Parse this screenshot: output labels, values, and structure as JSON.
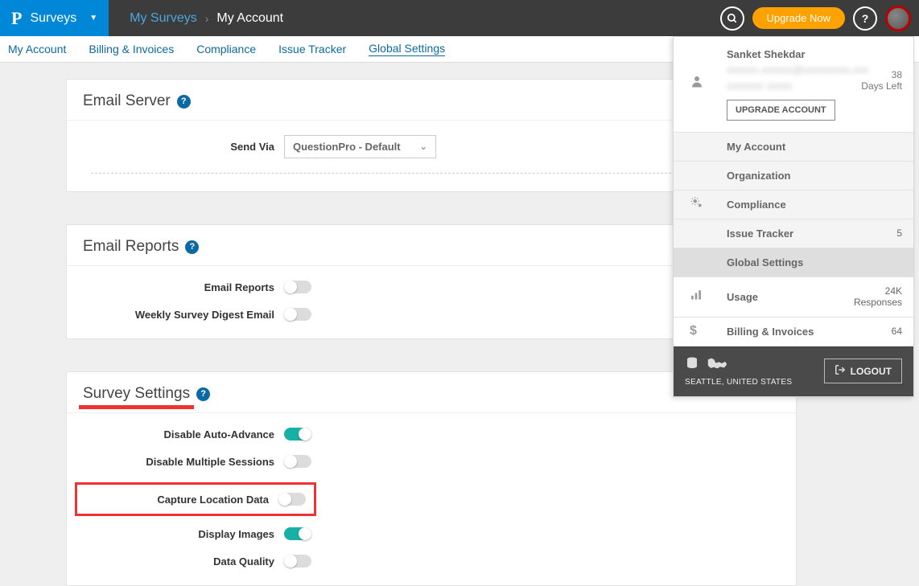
{
  "header": {
    "brand_label": "Surveys",
    "breadcrumb_parent": "My Surveys",
    "breadcrumb_current": "My Account",
    "upgrade_label": "Upgrade Now"
  },
  "subtabs": {
    "items": [
      "My Account",
      "Billing & Invoices",
      "Compliance",
      "Issue Tracker",
      "Global Settings"
    ],
    "active_index": 4
  },
  "panels": {
    "email_server": {
      "title": "Email Server",
      "send_via_label": "Send Via",
      "send_via_value": "QuestionPro - Default"
    },
    "email_reports": {
      "title": "Email Reports",
      "rows": [
        {
          "label": "Email Reports",
          "on": false
        },
        {
          "label": "Weekly Survey Digest Email",
          "on": false
        }
      ]
    },
    "survey_settings": {
      "title": "Survey Settings",
      "rows": [
        {
          "label": "Disable Auto-Advance",
          "on": true
        },
        {
          "label": "Disable Multiple Sessions",
          "on": false
        },
        {
          "label": "Capture Location Data",
          "on": false,
          "highlight": true
        },
        {
          "label": "Display Images",
          "on": true
        },
        {
          "label": "Data Quality",
          "on": false
        }
      ]
    }
  },
  "profile": {
    "name": "Sanket Shekdar",
    "days_left_number": "38",
    "days_left_label": "Days Left",
    "upgrade_label": "UPGRADE ACCOUNT",
    "menu": [
      {
        "label": "My Account"
      },
      {
        "label": "Organization"
      },
      {
        "label": "Compliance"
      },
      {
        "label": "Issue Tracker",
        "right": "5"
      },
      {
        "label": "Global Settings",
        "active": true
      },
      {
        "label": "Usage",
        "right": "24K",
        "right_sub": "Responses"
      },
      {
        "label": "Billing & Invoices",
        "right": "64"
      }
    ],
    "location": "SEATTLE, UNITED STATES",
    "logout_label": "LOGOUT"
  }
}
